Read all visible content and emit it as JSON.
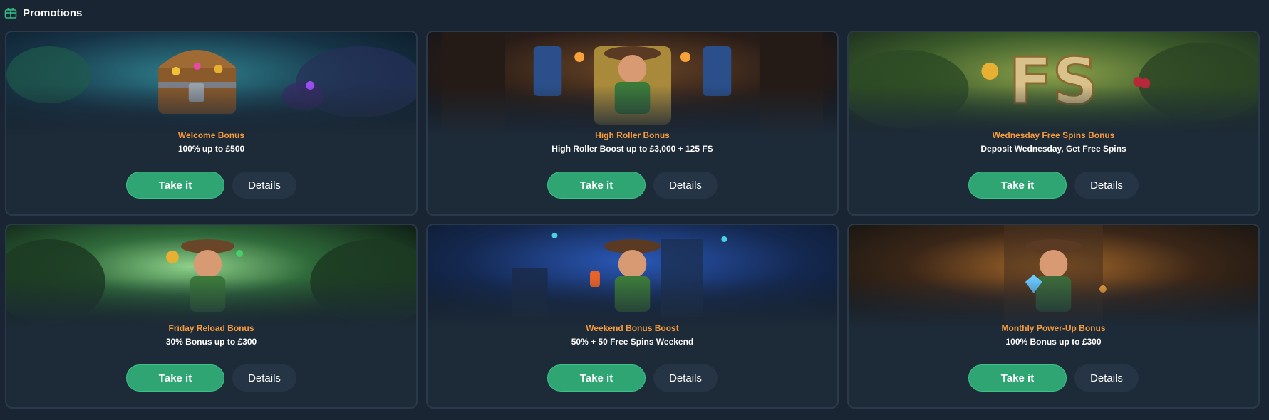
{
  "header": {
    "title": "Promotions",
    "icon": "gift-box-icon"
  },
  "promotions": [
    {
      "name": "Welcome Bonus",
      "description": "100% up to £500",
      "take_label": "Take it",
      "details_label": "Details",
      "scene": "treasure-chest-jungle"
    },
    {
      "name": "High Roller Bonus",
      "description": "High Roller Boost up to £3,000 + 125 FS",
      "take_label": "Take it",
      "details_label": "Details",
      "scene": "explorer-on-throne"
    },
    {
      "name": "Wednesday Free Spins Bonus",
      "description": "Deposit Wednesday, Get Free Spins",
      "take_label": "Take it",
      "details_label": "Details",
      "scene": "fs-stone-letters"
    },
    {
      "name": "Friday Reload Bonus",
      "description": "30% Bonus up to £300",
      "take_label": "Take it",
      "details_label": "Details",
      "scene": "explorer-jungle-cheer"
    },
    {
      "name": "Weekend Bonus Boost",
      "description": "50% + 50 Free Spins Weekend",
      "take_label": "Take it",
      "details_label": "Details",
      "scene": "explorer-cocktail-night"
    },
    {
      "name": "Monthly Power-Up Bonus",
      "description": "100% Bonus up to £300",
      "take_label": "Take it",
      "details_label": "Details",
      "scene": "explorer-diamond-temple"
    }
  ],
  "colors": {
    "background": "#1a2533",
    "card": "#1d2a38",
    "promo_name": "#f59a3c",
    "take_button": "#2fa574",
    "details_button": "#263545"
  }
}
